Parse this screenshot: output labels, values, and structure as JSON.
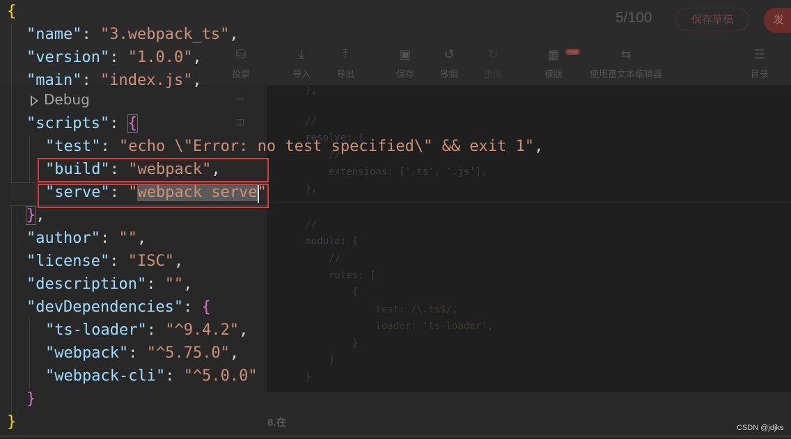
{
  "background_editor": {
    "counter": "5/100",
    "draft_button": "保存草稿",
    "publish_button": "发",
    "toolbar": [
      {
        "label": "投票",
        "icon": "vote-icon"
      },
      {
        "label": "导入",
        "icon": "import-icon"
      },
      {
        "label": "导出",
        "icon": "export-icon"
      },
      {
        "label": "保存",
        "icon": "save-icon"
      },
      {
        "label": "撤销",
        "icon": "undo-icon"
      },
      {
        "label": "重做",
        "icon": "redo-icon"
      },
      {
        "label": "模版",
        "icon": "template-icon"
      },
      {
        "label": "使用富文本编辑器",
        "icon": "switch-editor-icon"
      },
      {
        "label": "目录",
        "icon": "toc-icon"
      }
    ],
    "new_badge": "new",
    "code_lines": [
      "   },",
      "",
      "   //",
      "   resolve: {",
      "       //",
      "       extensions: ['.ts', '.js'],",
      "   },",
      "",
      "   //",
      "   module: {",
      "       //",
      "       rules: [",
      "           {",
      "               test: /\\.ts$/,",
      "               loader: 'ts-loader',",
      "           }",
      "       ]",
      "   }"
    ],
    "heading": "8.在",
    "watermark": "CSDN @jdjks"
  },
  "json_editor": {
    "debug_label": "Debug",
    "name_key": "\"name\"",
    "name_val": "\"3.webpack_ts\"",
    "version_key": "\"version\"",
    "version_val": "\"1.0.0\"",
    "main_key": "\"main\"",
    "main_val": "\"index.js\"",
    "scripts_key": "\"scripts\"",
    "test_key": "\"test\"",
    "test_val": "\"echo \\\"Error: no test specified\\\" && exit 1\"",
    "build_key": "\"build\"",
    "build_val": "\"webpack\"",
    "serve_key": "\"serve\"",
    "serve_val_q": "\"",
    "serve_val_sel": "webpack serve",
    "serve_val_end": "\"",
    "author_key": "\"author\"",
    "author_val": "\"\"",
    "license_key": "\"license\"",
    "license_val": "\"ISC\"",
    "description_key": "\"description\"",
    "description_val": "\"\"",
    "devdeps_key": "\"devDependencies\"",
    "tsloader_key": "\"ts-loader\"",
    "tsloader_val": "\"^9.4.2\"",
    "webpack_key": "\"webpack\"",
    "webpack_val": "\"^5.75.0\"",
    "webpackcli_key": "\"webpack-cli\"",
    "webpackcli_val": "\"^5.0.0\""
  },
  "colors": {
    "key": "#9cdcfe",
    "string": "#ce9178",
    "brace_level1": "#ffd700",
    "brace_level2": "#da70d6",
    "annotation_box": "#d93a3a"
  }
}
